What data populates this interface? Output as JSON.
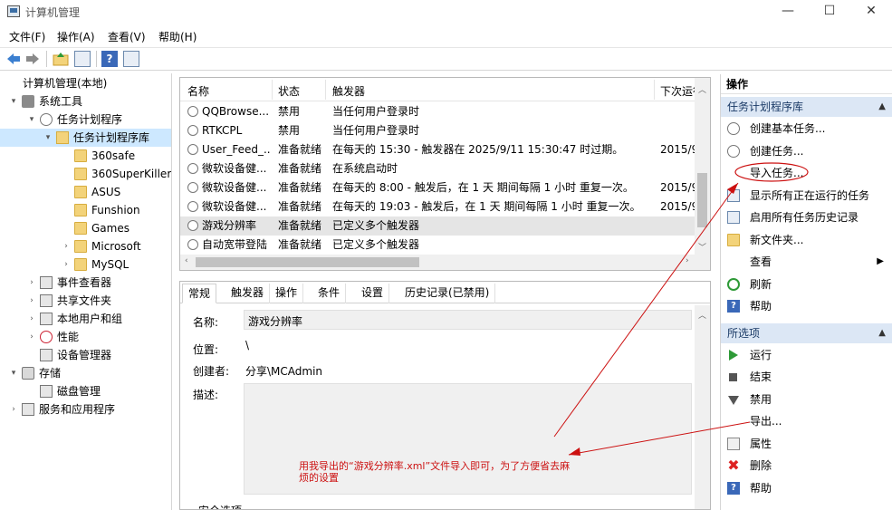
{
  "window": {
    "title": "计算机管理",
    "minimize": "—",
    "maximize": "☐",
    "close": "✕"
  },
  "menu": [
    "文件(F)",
    "操作(A)",
    "查看(V)",
    "帮助(H)"
  ],
  "toolbar": {
    "icons": [
      "back-arrow-icon",
      "forward-arrow-icon",
      "up-folder-icon",
      "show-hide-tree-icon",
      "help-icon",
      "action-pane-icon"
    ],
    "help_glyph": "?"
  },
  "tree": [
    {
      "label": "计算机管理(本地)",
      "level": 0,
      "icon": "computer",
      "twisty": ""
    },
    {
      "label": "系统工具",
      "level": 1,
      "icon": "tools",
      "twisty": "▾"
    },
    {
      "label": "任务计划程序",
      "level": 2,
      "icon": "clock",
      "twisty": "▾"
    },
    {
      "label": "任务计划程序库",
      "level": 3,
      "icon": "clockfolder",
      "twisty": "▾",
      "selected": true
    },
    {
      "label": "360safe",
      "level": 4,
      "icon": "folder",
      "twisty": ""
    },
    {
      "label": "360SuperKiller",
      "level": 4,
      "icon": "folder",
      "twisty": ""
    },
    {
      "label": "ASUS",
      "level": 4,
      "icon": "folder",
      "twisty": ""
    },
    {
      "label": "Funshion",
      "level": 4,
      "icon": "folder",
      "twisty": ""
    },
    {
      "label": "Games",
      "level": 4,
      "icon": "folder",
      "twisty": ""
    },
    {
      "label": "Microsoft",
      "level": 4,
      "icon": "folder",
      "twisty": "›"
    },
    {
      "label": "MySQL",
      "level": 4,
      "icon": "folder",
      "twisty": "›"
    },
    {
      "label": "事件查看器",
      "level": 2,
      "icon": "generic",
      "twisty": "›"
    },
    {
      "label": "共享文件夹",
      "level": 2,
      "icon": "generic",
      "twisty": "›"
    },
    {
      "label": "本地用户和组",
      "level": 2,
      "icon": "generic",
      "twisty": "›"
    },
    {
      "label": "性能",
      "level": 2,
      "icon": "perf",
      "twisty": "›"
    },
    {
      "label": "设备管理器",
      "level": 2,
      "icon": "generic",
      "twisty": ""
    },
    {
      "label": "存储",
      "level": 1,
      "icon": "store",
      "twisty": "▾"
    },
    {
      "label": "磁盘管理",
      "level": 2,
      "icon": "generic",
      "twisty": ""
    },
    {
      "label": "服务和应用程序",
      "level": 1,
      "icon": "generic",
      "twisty": "›"
    }
  ],
  "tasks": {
    "columns": [
      "名称",
      "状态",
      "触发器",
      "下次运行"
    ],
    "rows": [
      {
        "name": "QQBrowse...",
        "status": "禁用",
        "trigger": "当任何用户登录时",
        "next": ""
      },
      {
        "name": "RTKCPL",
        "status": "禁用",
        "trigger": "当任何用户登录时",
        "next": ""
      },
      {
        "name": "User_Feed_...",
        "status": "准备就绪",
        "trigger": "在每天的 15:30 - 触发器在 2025/9/11 15:30:47 时过期。",
        "next": "2015/9"
      },
      {
        "name": "微软设备健...",
        "status": "准备就绪",
        "trigger": "在系统启动时",
        "next": ""
      },
      {
        "name": "微软设备健...",
        "status": "准备就绪",
        "trigger": "在每天的 8:00 - 触发后，在 1 天 期间每隔 1 小时 重复一次。",
        "next": "2015/9"
      },
      {
        "name": "微软设备健...",
        "status": "准备就绪",
        "trigger": "在每天的 19:03 - 触发后，在 1 天 期间每隔 1 小时 重复一次。",
        "next": "2015/9"
      },
      {
        "name": "游戏分辨率",
        "status": "准备就绪",
        "trigger": "已定义多个触发器",
        "next": "",
        "selected": true
      },
      {
        "name": "自动宽带登陆",
        "status": "准备就绪",
        "trigger": "已定义多个触发器",
        "next": ""
      }
    ]
  },
  "detail": {
    "tabs": [
      "常规",
      "触发器",
      "操作",
      "条件",
      "设置",
      "历史记录(已禁用)"
    ],
    "name_label": "名称:",
    "name_value": "游戏分辨率",
    "location_label": "位置:",
    "location_value": "\\",
    "author_label": "创建者:",
    "author_value": "分享\\MCAdmin",
    "desc_label": "描述:",
    "security_label": "安全选项"
  },
  "actions": {
    "title": "操作",
    "group1": "任务计划程序库",
    "items1": [
      {
        "label": "创建基本任务...",
        "icon": "clock"
      },
      {
        "label": "创建任务...",
        "icon": "clock"
      },
      {
        "label": "导入任务...",
        "icon": "none"
      },
      {
        "label": "显示所有正在运行的任务",
        "icon": "box"
      },
      {
        "label": "启用所有任务历史记录",
        "icon": "box"
      },
      {
        "label": "新文件夹...",
        "icon": "folder"
      },
      {
        "label": "查看",
        "icon": "none",
        "submenu": "▶"
      },
      {
        "label": "刷新",
        "icon": "refresh"
      },
      {
        "label": "帮助",
        "icon": "helpb"
      }
    ],
    "group2": "所选项",
    "items2": [
      {
        "label": "运行",
        "icon": "green"
      },
      {
        "label": "结束",
        "icon": "square"
      },
      {
        "label": "禁用",
        "icon": "down"
      },
      {
        "label": "导出...",
        "icon": "none"
      },
      {
        "label": "属性",
        "icon": "props"
      },
      {
        "label": "删除",
        "icon": "xred"
      },
      {
        "label": "帮助",
        "icon": "helpb"
      }
    ],
    "caret": "▲"
  },
  "annotation": {
    "text": "用我导出的“游戏分辨率.xml”文件导入即可，为了方便省去麻烦的设置",
    "color": "#cc1111"
  }
}
